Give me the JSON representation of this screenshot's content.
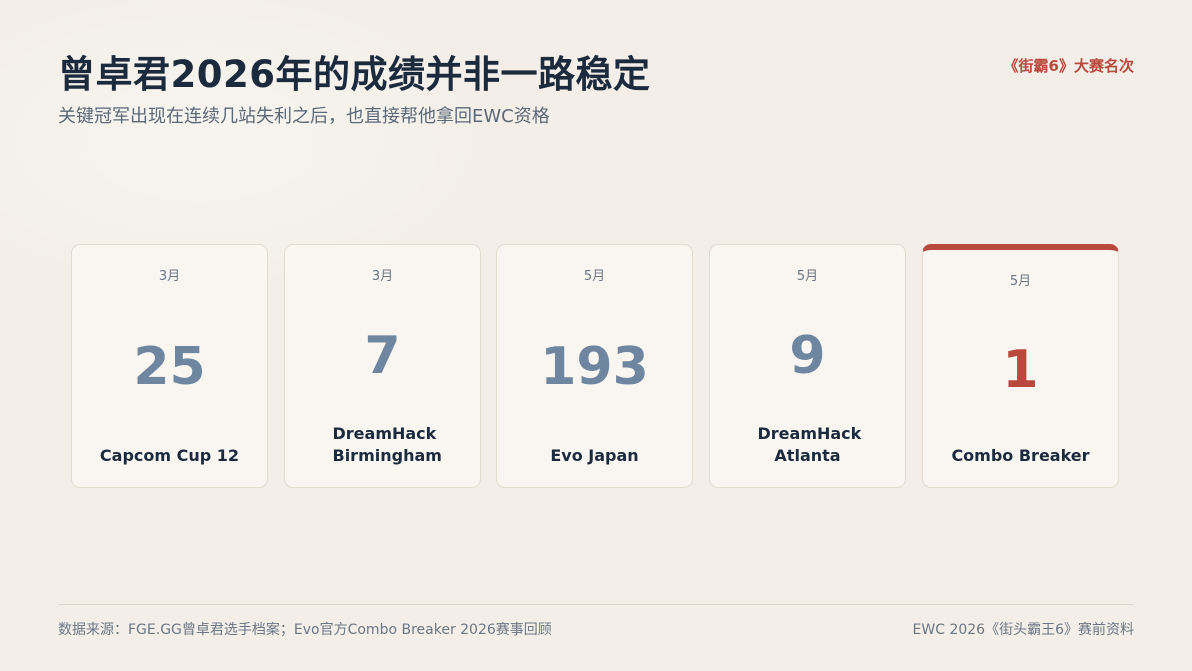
{
  "header": {
    "title": "曾卓君2026年的成绩并非一路稳定",
    "subtitle": "关键冠军出现在连续几站失利之后，也直接帮他拿回EWC资格",
    "tag": "《街霸6》大赛名次"
  },
  "cards": [
    {
      "month": "3月",
      "rank": "25",
      "event": "Capcom Cup 12",
      "highlight": false
    },
    {
      "month": "3月",
      "rank": "7",
      "event": "DreamHack Birmingham",
      "highlight": false
    },
    {
      "month": "5月",
      "rank": "193",
      "event": "Evo Japan",
      "highlight": false
    },
    {
      "month": "5月",
      "rank": "9",
      "event": "DreamHack Atlanta",
      "highlight": false
    },
    {
      "month": "5月",
      "rank": "1",
      "event": "Combo Breaker",
      "highlight": true
    }
  ],
  "footer": {
    "source": "数据来源：FGE.GG曾卓君选手档案；Evo官方Combo Breaker 2026赛事回顾",
    "note": "EWC 2026《街头霸王6》赛前资料"
  },
  "colors": {
    "background": "#f3efe8",
    "accent": "#b8493c",
    "rank_muted": "#6f86a0",
    "title": "#1b2a3d"
  }
}
